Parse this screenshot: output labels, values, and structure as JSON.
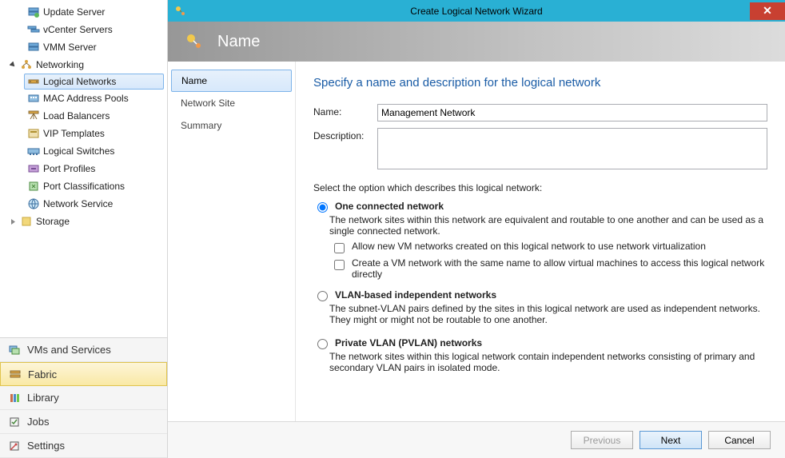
{
  "tree": {
    "items": [
      {
        "label": "Update Server",
        "icon": "server-refresh-icon"
      },
      {
        "label": "vCenter Servers",
        "icon": "servers-icon"
      },
      {
        "label": "VMM Server",
        "icon": "server-icon"
      }
    ],
    "networking": {
      "label": "Networking",
      "children": [
        {
          "label": "Logical Networks",
          "icon": "logical-network-icon",
          "selected": true
        },
        {
          "label": "MAC Address Pools",
          "icon": "mac-pool-icon"
        },
        {
          "label": "Load Balancers",
          "icon": "load-balancer-icon"
        },
        {
          "label": "VIP Templates",
          "icon": "vip-template-icon"
        },
        {
          "label": "Logical Switches",
          "icon": "logical-switch-icon"
        },
        {
          "label": "Port Profiles",
          "icon": "port-profile-icon"
        },
        {
          "label": "Port Classifications",
          "icon": "port-class-icon"
        },
        {
          "label": "Network Service",
          "icon": "network-service-icon"
        }
      ]
    },
    "storage": {
      "label": "Storage"
    }
  },
  "bottomNav": {
    "items": [
      {
        "label": "VMs and Services",
        "icon": "vm-services-icon"
      },
      {
        "label": "Fabric",
        "icon": "fabric-icon",
        "selected": true
      },
      {
        "label": "Library",
        "icon": "library-icon"
      },
      {
        "label": "Jobs",
        "icon": "jobs-icon"
      },
      {
        "label": "Settings",
        "icon": "settings-icon"
      }
    ]
  },
  "wizard": {
    "title": "Create Logical Network Wizard",
    "bannerTitle": "Name",
    "steps": [
      {
        "label": "Name",
        "selected": true
      },
      {
        "label": "Network Site"
      },
      {
        "label": "Summary"
      }
    ],
    "heading": "Specify a name and description for the logical network",
    "nameLabel": "Name:",
    "nameValue": "Management Network",
    "descLabel": "Description:",
    "descValue": "",
    "optionIntro": "Select the option which describes this logical network:",
    "options": {
      "one": {
        "label": "One connected network",
        "desc": "The network sites within this network are equivalent and routable to one another and can be used as a single connected network.",
        "sub1": "Allow new VM networks created on this logical network to use network virtualization",
        "sub2": "Create a VM network with the same name to allow virtual machines to access this logical network directly"
      },
      "vlan": {
        "label": "VLAN-based independent networks",
        "desc": "The subnet-VLAN pairs defined by the sites in this logical network are used as independent networks. They might or might not be routable to one another."
      },
      "pvlan": {
        "label": "Private VLAN (PVLAN) networks",
        "desc": "The network sites within this logical network contain independent networks consisting of primary and secondary VLAN pairs in isolated mode."
      }
    },
    "buttons": {
      "previous": "Previous",
      "next": "Next",
      "cancel": "Cancel"
    }
  }
}
